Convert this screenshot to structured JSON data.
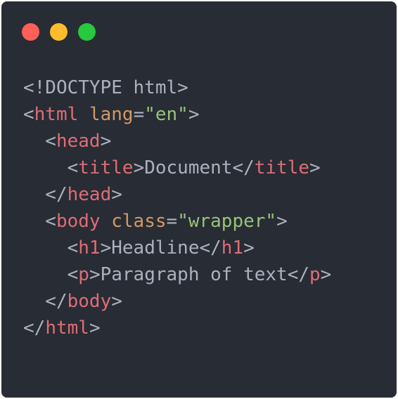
{
  "window": {
    "controls": [
      {
        "name": "close",
        "color": "#ff5f56"
      },
      {
        "name": "minimize",
        "color": "#ffbd2e"
      },
      {
        "name": "maximize",
        "color": "#27c93f"
      }
    ]
  },
  "code": {
    "lines": [
      [
        {
          "t": "<!DOCTYPE html>",
          "c": "punct"
        }
      ],
      [
        {
          "t": "<",
          "c": "punct"
        },
        {
          "t": "html",
          "c": "tag"
        },
        {
          "t": " ",
          "c": "txt"
        },
        {
          "t": "lang",
          "c": "attr"
        },
        {
          "t": "=",
          "c": "punct"
        },
        {
          "t": "\"en\"",
          "c": "str"
        },
        {
          "t": ">",
          "c": "punct"
        }
      ],
      [
        {
          "t": "  <",
          "c": "punct"
        },
        {
          "t": "head",
          "c": "tag"
        },
        {
          "t": ">",
          "c": "punct"
        }
      ],
      [
        {
          "t": "    <",
          "c": "punct"
        },
        {
          "t": "title",
          "c": "tag"
        },
        {
          "t": ">",
          "c": "punct"
        },
        {
          "t": "Document",
          "c": "txt"
        },
        {
          "t": "</",
          "c": "punct"
        },
        {
          "t": "title",
          "c": "tag"
        },
        {
          "t": ">",
          "c": "punct"
        }
      ],
      [
        {
          "t": "  </",
          "c": "punct"
        },
        {
          "t": "head",
          "c": "tag"
        },
        {
          "t": ">",
          "c": "punct"
        }
      ],
      [
        {
          "t": "  <",
          "c": "punct"
        },
        {
          "t": "body",
          "c": "tag"
        },
        {
          "t": " ",
          "c": "txt"
        },
        {
          "t": "class",
          "c": "attr"
        },
        {
          "t": "=",
          "c": "punct"
        },
        {
          "t": "\"wrapper\"",
          "c": "str"
        },
        {
          "t": ">",
          "c": "punct"
        }
      ],
      [
        {
          "t": "    <",
          "c": "punct"
        },
        {
          "t": "h1",
          "c": "tag"
        },
        {
          "t": ">",
          "c": "punct"
        },
        {
          "t": "Headline",
          "c": "txt"
        },
        {
          "t": "</",
          "c": "punct"
        },
        {
          "t": "h1",
          "c": "tag"
        },
        {
          "t": ">",
          "c": "punct"
        }
      ],
      [
        {
          "t": "    <",
          "c": "punct"
        },
        {
          "t": "p",
          "c": "tag"
        },
        {
          "t": ">",
          "c": "punct"
        },
        {
          "t": "Paragraph of text",
          "c": "txt"
        },
        {
          "t": "</",
          "c": "punct"
        },
        {
          "t": "p",
          "c": "tag"
        },
        {
          "t": ">",
          "c": "punct"
        }
      ],
      [
        {
          "t": "  </",
          "c": "punct"
        },
        {
          "t": "body",
          "c": "tag"
        },
        {
          "t": ">",
          "c": "punct"
        }
      ],
      [
        {
          "t": "</",
          "c": "punct"
        },
        {
          "t": "html",
          "c": "tag"
        },
        {
          "t": ">",
          "c": "punct"
        }
      ]
    ]
  },
  "colors": {
    "background": "#282c34",
    "tag": "#e06c75",
    "attribute": "#d19a66",
    "string": "#98c379",
    "text": "#abb2bf"
  }
}
